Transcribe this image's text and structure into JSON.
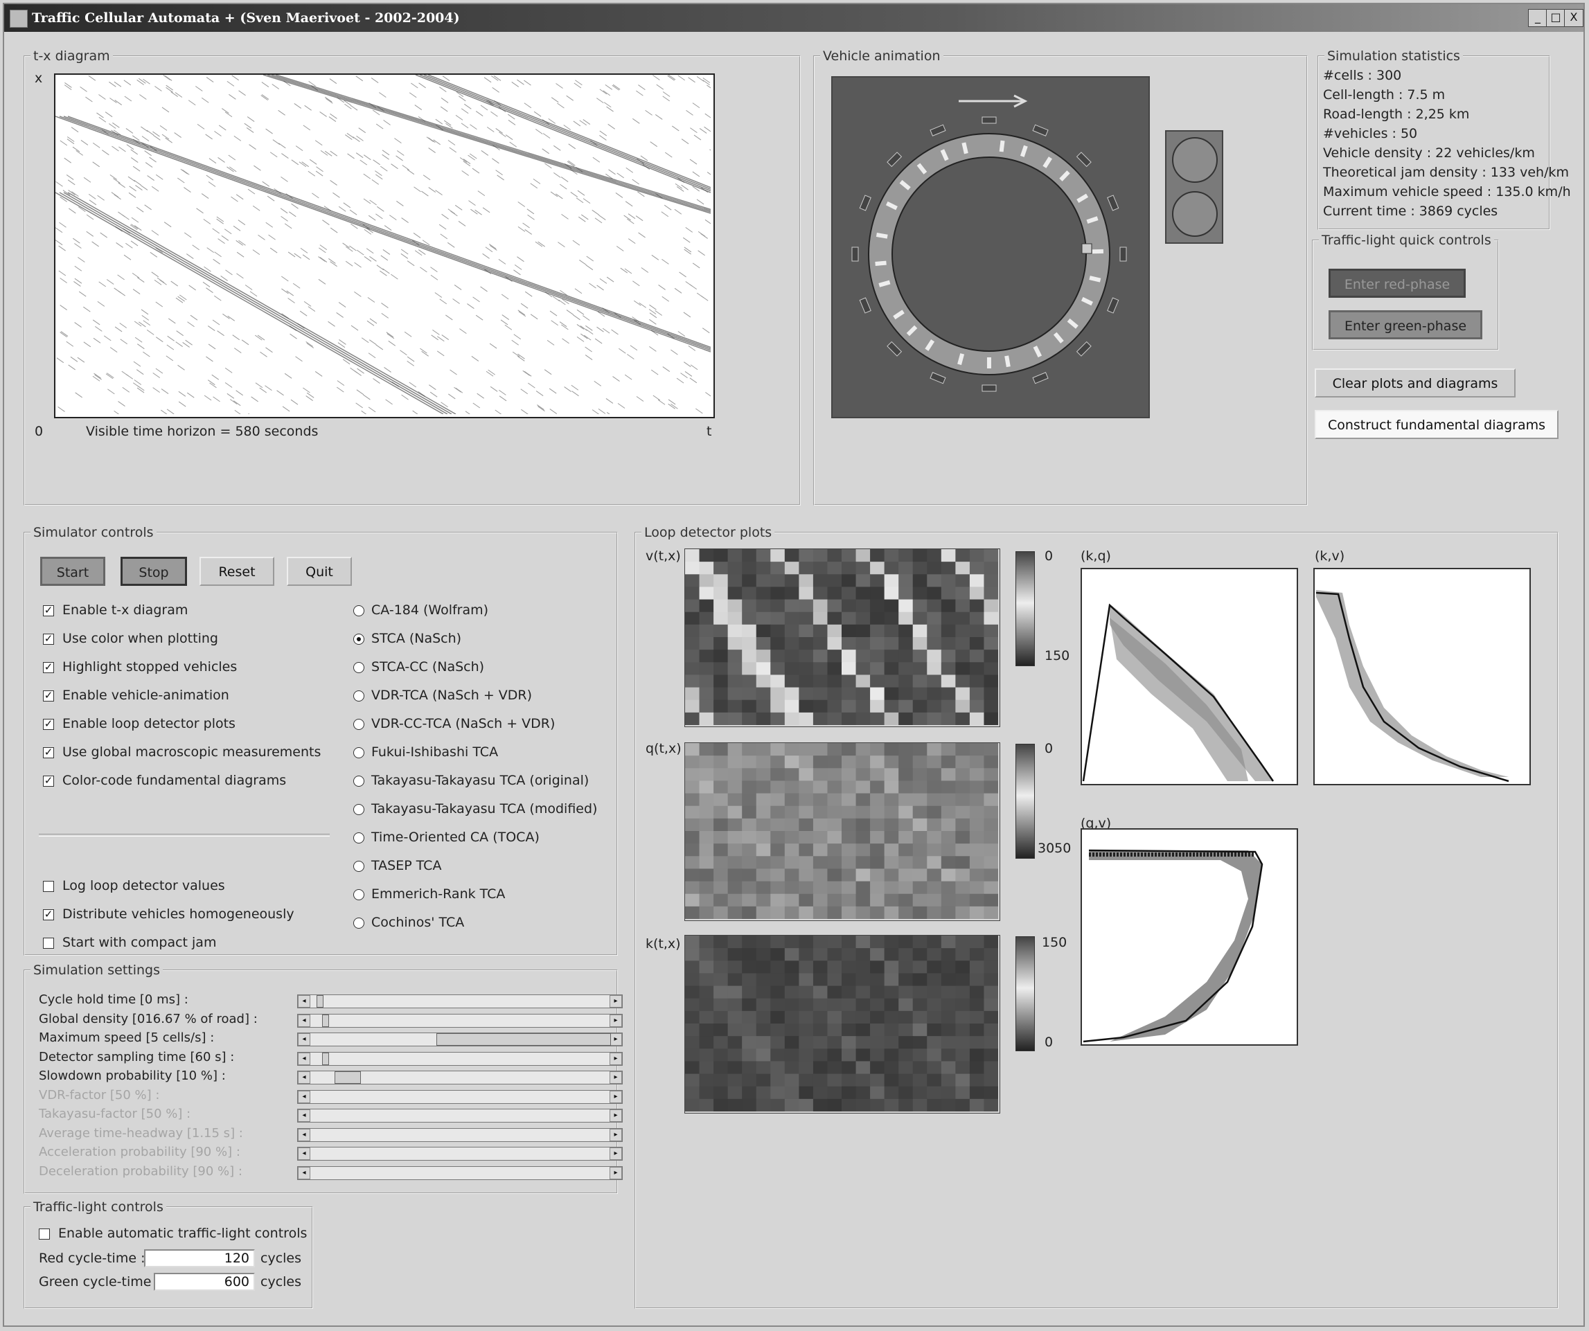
{
  "window": {
    "title": "Traffic Cellular Automata + (Sven Maerivoet - 2002-2004)",
    "controls": [
      "_",
      "□",
      "X"
    ]
  },
  "tx_diagram": {
    "legend": "t-x diagram",
    "x_axis": "x",
    "origin": "0",
    "t_axis": "t",
    "horizon_text": "Visible time horizon = 580 seconds"
  },
  "vehicle_animation": {
    "legend": "Vehicle animation"
  },
  "statistics": {
    "legend": "Simulation statistics",
    "lines": [
      "#cells : 300",
      "Cell-length : 7.5 m",
      "Road-length : 2,25 km",
      "#vehicles : 50",
      "Vehicle density : 22 vehicles/km",
      "Theoretical jam density : 133 veh/km",
      "Maximum vehicle speed : 135.0 km/h",
      "Current time : 3869 cycles"
    ]
  },
  "traffic_light_quick": {
    "legend": "Traffic-light quick controls",
    "red_button": "Enter red-phase",
    "green_button": "Enter green-phase"
  },
  "actions": {
    "clear": "Clear plots and diagrams",
    "construct": "Construct fundamental diagrams"
  },
  "simulator_controls": {
    "legend": "Simulator controls",
    "buttons": [
      "Start",
      "Stop",
      "Reset",
      "Quit"
    ],
    "checkboxes": [
      {
        "label": "Enable t-x diagram",
        "checked": true
      },
      {
        "label": "Use color when plotting",
        "checked": true
      },
      {
        "label": "Highlight stopped vehicles",
        "checked": true
      },
      {
        "label": "Enable vehicle-animation",
        "checked": true
      },
      {
        "label": "Enable loop detector plots",
        "checked": true
      },
      {
        "label": "Use global macroscopic measurements",
        "checked": true
      },
      {
        "label": "Color-code fundamental diagrams",
        "checked": true
      }
    ],
    "checkboxes2": [
      {
        "label": "Log loop detector values",
        "checked": false
      },
      {
        "label": "Distribute vehicles homogeneously",
        "checked": true
      },
      {
        "label": "Start with compact jam",
        "checked": false
      }
    ],
    "models": [
      {
        "label": "CA-184 (Wolfram)",
        "selected": false
      },
      {
        "label": "STCA (NaSch)",
        "selected": true
      },
      {
        "label": "STCA-CC (NaSch)",
        "selected": false
      },
      {
        "label": "VDR-TCA (NaSch + VDR)",
        "selected": false
      },
      {
        "label": "VDR-CC-TCA (NaSch + VDR)",
        "selected": false
      },
      {
        "label": "Fukui-Ishibashi TCA",
        "selected": false
      },
      {
        "label": "Takayasu-Takayasu TCA (original)",
        "selected": false
      },
      {
        "label": "Takayasu-Takayasu TCA (modified)",
        "selected": false
      },
      {
        "label": "Time-Oriented CA (TOCA)",
        "selected": false
      },
      {
        "label": "TASEP TCA",
        "selected": false
      },
      {
        "label": "Emmerich-Rank TCA",
        "selected": false
      },
      {
        "label": "Cochinos' TCA",
        "selected": false
      }
    ]
  },
  "simulation_settings": {
    "legend": "Simulation settings",
    "sliders": [
      {
        "label": "Cycle hold time [0 ms] :",
        "enabled": true,
        "value": 0.0,
        "thumb": 0.02
      },
      {
        "label": "Global density [016.67 % of road] :",
        "enabled": true,
        "value": 0.1667,
        "thumb": 0.04
      },
      {
        "label": "Maximum speed [5 cells/s] :",
        "enabled": true,
        "value": 0.5,
        "thumb": 0.42
      },
      {
        "label": "Detector sampling time [60 s] :",
        "enabled": true,
        "value": 0.1,
        "thumb": 0.04
      },
      {
        "label": "Slowdown probability [10 %] :",
        "enabled": true,
        "value": 0.1,
        "thumb": 0.08
      },
      {
        "label": "VDR-factor [50 %] :",
        "enabled": false,
        "value": 0.5,
        "thumb": 0
      },
      {
        "label": "Takayasu-factor [50 %] :",
        "enabled": false,
        "value": 0.5,
        "thumb": 0
      },
      {
        "label": "Average time-headway [1.15 s] :",
        "enabled": false,
        "value": 0.1,
        "thumb": 0
      },
      {
        "label": "Acceleration probability [90 %] :",
        "enabled": false,
        "value": 0.9,
        "thumb": 0
      },
      {
        "label": "Deceleration probability [90 %] :",
        "enabled": false,
        "value": 0.9,
        "thumb": 0
      }
    ]
  },
  "traffic_light_controls": {
    "legend": "Traffic-light controls",
    "auto_label": "Enable automatic traffic-light controls",
    "auto_checked": false,
    "red_label": "Red cycle-time :",
    "red_value": "120",
    "green_label": "Green cycle-time :",
    "green_value": "600",
    "unit": "cycles"
  },
  "loop_detector": {
    "legend": "Loop detector plots",
    "v_label": "v(t,x)",
    "v_scale": [
      "0",
      "150"
    ],
    "q_label": "q(t,x)",
    "q_scale": [
      "0",
      "3050"
    ],
    "k_label": "k(t,x)",
    "k_scale": [
      "150",
      "0"
    ],
    "kq_label": "(k,q)",
    "kv_label": "(k,v)",
    "qv_label": "(q,v)"
  },
  "colors": {
    "panel": "#d6d6d6",
    "animation_bg": "#595959",
    "red_button": "#5e5e5e",
    "green_button": "#8e8e8e"
  }
}
